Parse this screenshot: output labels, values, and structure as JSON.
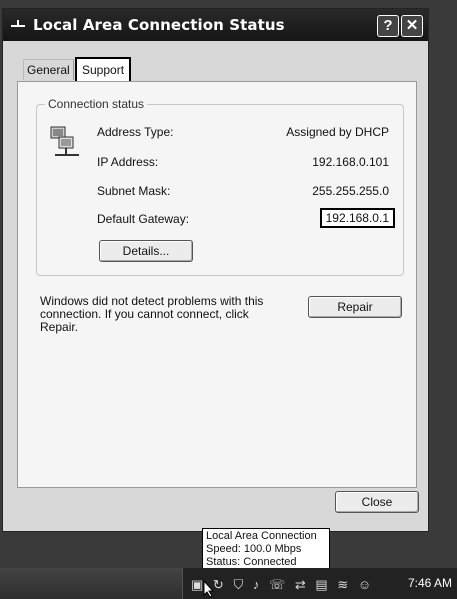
{
  "window": {
    "title": "Local Area Connection Status",
    "help_glyph": "?",
    "close_glyph": "✕"
  },
  "tabs": [
    {
      "label": "General"
    },
    {
      "label": "Support"
    }
  ],
  "connection_status": {
    "group_label": "Connection status",
    "rows": [
      {
        "label": "Address Type:",
        "value": "Assigned by DHCP"
      },
      {
        "label": "IP Address:",
        "value": "192.168.0.101"
      },
      {
        "label": "Subnet Mask:",
        "value": "255.255.255.0"
      },
      {
        "label": "Default Gateway:",
        "value": "192.168.0.1"
      }
    ],
    "details_button": "Details..."
  },
  "diagnosis": {
    "message": "Windows did not detect problems with this connection. If you cannot connect, click Repair.",
    "repair_button": "Repair"
  },
  "footer": {
    "close_button": "Close"
  },
  "tooltip": {
    "line1": "Local Area Connection",
    "line2": "Speed: 100.0 Mbps",
    "line3": "Status: Connected"
  },
  "taskbar": {
    "clock": "7:46 AM",
    "tray_icons": [
      "network-icon",
      "refresh-icon",
      "shield-icon",
      "volume-icon",
      "phone-icon",
      "connection-icon",
      "printer-icon",
      "wireless-icon",
      "messenger-icon"
    ]
  }
}
